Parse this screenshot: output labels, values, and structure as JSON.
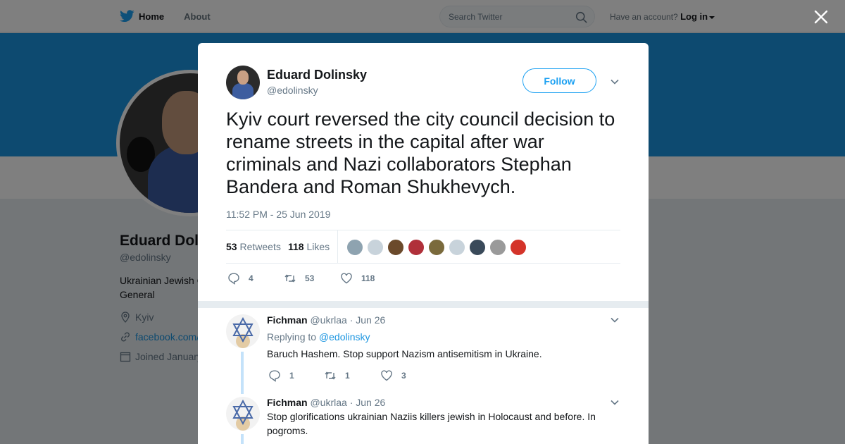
{
  "nav": {
    "home_label": "Home",
    "about_label": "About",
    "search_placeholder": "Search Twitter",
    "account_prompt": "Have an account?",
    "login_label": "Log in"
  },
  "profile": {
    "name": "Eduard Dol",
    "handle": "@edolinsky",
    "bio": "Ukrainian Jewish C General",
    "location": "Kyiv",
    "link": "facebook.com/",
    "joined": "Joined January"
  },
  "tweet": {
    "author_name": "Eduard Dolinsky",
    "author_handle": "@edolinsky",
    "follow_label": "Follow",
    "text": "Kyiv court reversed the city council decision to rename streets in the capital after war criminals and Nazi collaborators Stephan Bandera and Roman Shukhevych.",
    "timestamp": "11:52 PM - 25 Jun 2019",
    "retweets_count": "53",
    "retweets_label": "Retweets",
    "likes_count": "118",
    "likes_label": "Likes",
    "actions": {
      "replies": "4",
      "retweets": "53",
      "likes": "118"
    },
    "liker_colors": [
      "#8ea3b0",
      "#c8d3db",
      "#6b4a2b",
      "#b0303a",
      "#7a6a3c",
      "#c8d3db",
      "#3a4a5a",
      "#9a9a9a",
      "#d4342a"
    ]
  },
  "replies": [
    {
      "name": "Fichman",
      "handle": "@ukrlaa",
      "date": "· Jun 26",
      "replying_prefix": "Replying to",
      "replying_to": "@edolinsky",
      "text": "Baruch Hashem. Stop support Nazism antisemitism in Ukraine.",
      "actions": {
        "replies": "1",
        "retweets": "1",
        "likes": "3"
      }
    },
    {
      "name": "Fichman",
      "handle": "@ukrlaa",
      "date": "· Jun 26",
      "text": "Stop glorifications ukrainian Naziis killers jewish in Holocaust and before. In pogroms."
    }
  ],
  "colors": {
    "accent": "#1da1f2",
    "banner": "#1b95e0",
    "thread": "#c4e2fa"
  },
  "icons": [
    "twitter-bird-icon",
    "search-icon",
    "close-icon",
    "chevron-down-icon",
    "reply-icon",
    "retweet-icon",
    "like-icon",
    "location-icon",
    "link-icon",
    "calendar-icon",
    "star-of-david-icon"
  ]
}
